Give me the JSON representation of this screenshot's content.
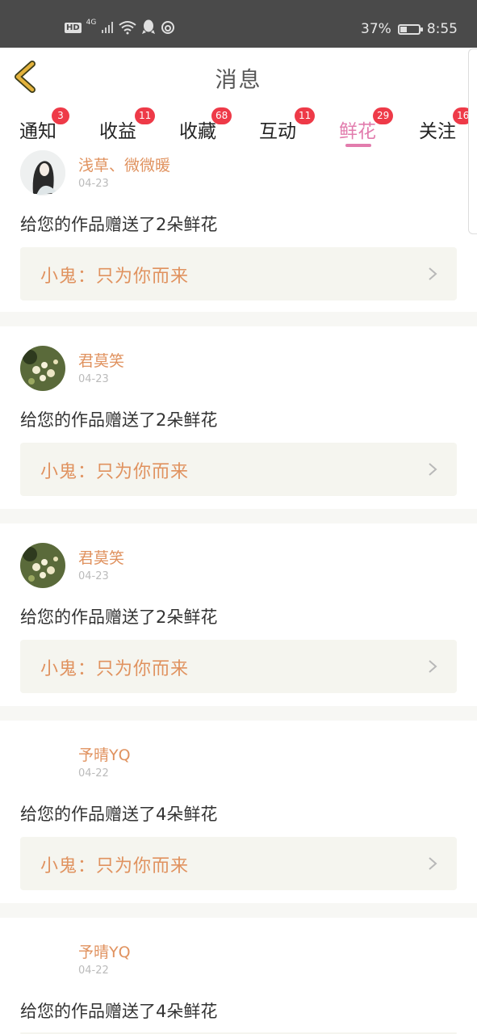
{
  "status_bar": {
    "hd": "HD",
    "network": "4G",
    "battery_text": "37%",
    "battery_level": 0.37,
    "time": "8:55",
    "icons": [
      "signal-icon",
      "wifi-icon",
      "qq-icon",
      "netease-music-icon"
    ]
  },
  "header": {
    "title": "消息"
  },
  "tabs": [
    {
      "label": "通知",
      "badge": "3"
    },
    {
      "label": "收益",
      "badge": "11"
    },
    {
      "label": "收藏",
      "badge": "68"
    },
    {
      "label": "互动",
      "badge": "11"
    },
    {
      "label": "鲜花",
      "badge": "29",
      "active": true
    },
    {
      "label": "关注",
      "badge": "16"
    }
  ],
  "messages": [
    {
      "user": "浅草、微微暖",
      "date": "04-23",
      "text": "给您的作品赠送了2朵鲜花",
      "work": "小鬼：只为你而来",
      "avatar": "avatar-girl"
    },
    {
      "user": "君莫笑",
      "date": "04-23",
      "text": "给您的作品赠送了2朵鲜花",
      "work": "小鬼：只为你而来",
      "avatar": "avatar-flowers"
    },
    {
      "user": "君莫笑",
      "date": "04-23",
      "text": "给您的作品赠送了2朵鲜花",
      "work": "小鬼：只为你而来",
      "avatar": "avatar-flowers"
    },
    {
      "user": "予晴YQ",
      "date": "04-22",
      "text": "给您的作品赠送了4朵鲜花",
      "work": "小鬼：只为你而来",
      "avatar": ""
    },
    {
      "user": "予晴YQ",
      "date": "04-22",
      "text": "给您的作品赠送了4朵鲜花",
      "work": "",
      "avatar": ""
    }
  ],
  "colors": {
    "accent": "#e27cad",
    "badge": "#ee3a48",
    "name": "#e0925f",
    "quote_bg": "#f5f5ef",
    "back_icon": "#d9a11e"
  }
}
